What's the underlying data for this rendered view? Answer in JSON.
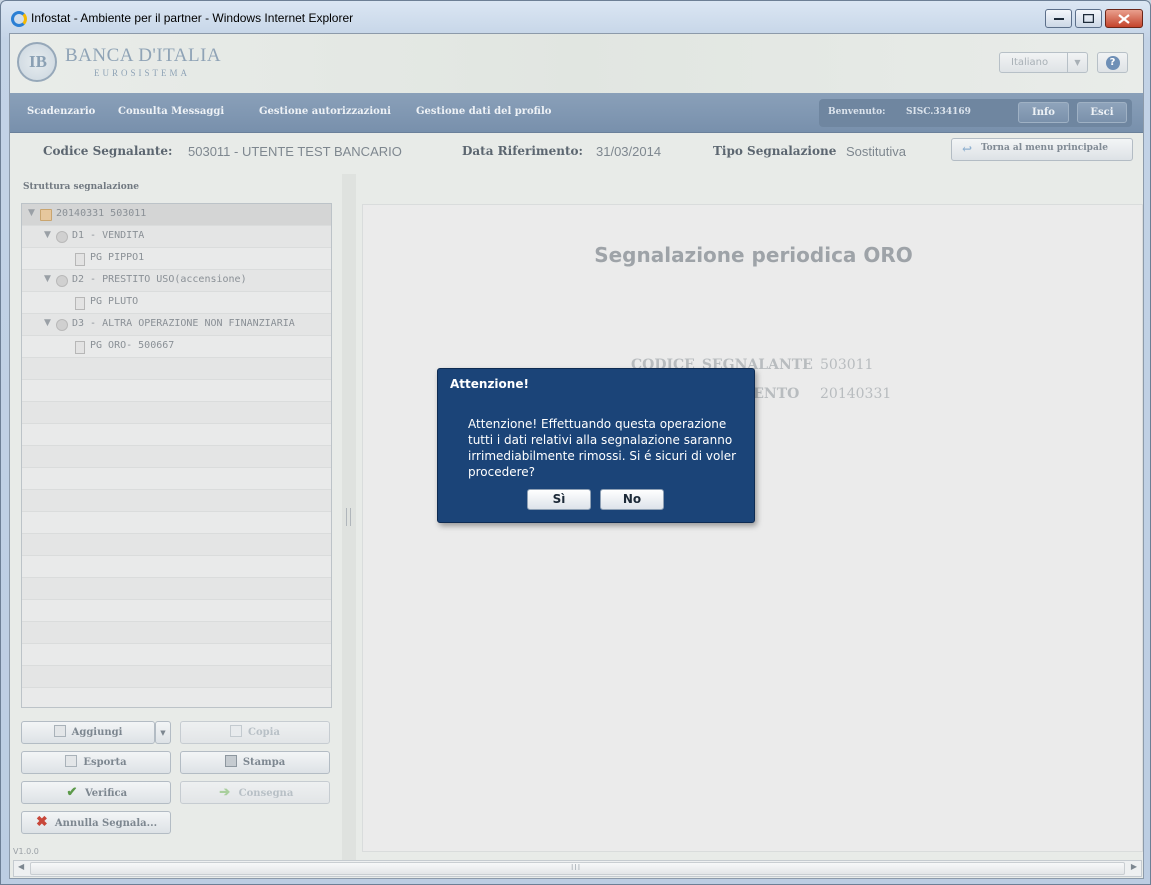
{
  "window": {
    "title": "Infostat - Ambiente per il partner - Windows Internet Explorer"
  },
  "logo": {
    "name": "BANCA D'ITALIA",
    "subtitle": "EUROSISTEMA"
  },
  "header": {
    "language": "Italiano"
  },
  "nav": {
    "items": [
      "Scadenzario",
      "Consulta Messaggi",
      "Gestione autorizzazioni",
      "Gestione dati del profilo"
    ],
    "welcome_label": "Benvenuto:",
    "user": "SISC.334169",
    "info": "Info",
    "logout": "Esci"
  },
  "info": {
    "codice_label": "Codice Segnalante:",
    "codice_value": "503011 - UTENTE TEST BANCARIO",
    "data_label": "Data Riferimento:",
    "data_value": "31/03/2014",
    "tipo_label": "Tipo Segnalazione",
    "tipo_value": "Sostitutiva",
    "back_button": "Torna al menu principale"
  },
  "left": {
    "title": "Struttura segnalazione",
    "tree": [
      {
        "label": "20140331 503011",
        "icon": "folder-icon"
      },
      {
        "label": "D1 - VENDITA",
        "icon": "circle-icon"
      },
      {
        "label": "PG PIPPO1",
        "icon": "page-icon"
      },
      {
        "label": "D2 - PRESTITO USO(accensione)",
        "icon": "circle-icon"
      },
      {
        "label": "PG PLUTO",
        "icon": "page-icon"
      },
      {
        "label": "D3 - ALTRA OPERAZIONE NON FINANZIARIA",
        "icon": "circle-icon"
      },
      {
        "label": "PG ORO- 500667",
        "icon": "page-icon"
      }
    ],
    "buttons": {
      "aggiungi": "Aggiungi",
      "copia": "Copia",
      "esporta": "Esporta",
      "stampa": "Stampa",
      "verifica": "Verifica",
      "consegna": "Consegna",
      "annulla": "Annulla Segnala..."
    },
    "version": "V1.0.0"
  },
  "main": {
    "title": "Segnalazione periodica ORO",
    "codice_key": "CODICE_SEGNALANTE",
    "codice_val": "503011",
    "data_key": "DATA_RIFERIMENTO",
    "data_val": "20140331"
  },
  "modal": {
    "title": "Attenzione!",
    "message": "Attenzione! Effettuando questa operazione tutti i dati relativi alla segnalazione saranno irrimediabilmente rimossi. Si é sicuri di voler procedere?",
    "yes": "Sì",
    "no": "No"
  },
  "scrollbar": {
    "grip": "III"
  }
}
